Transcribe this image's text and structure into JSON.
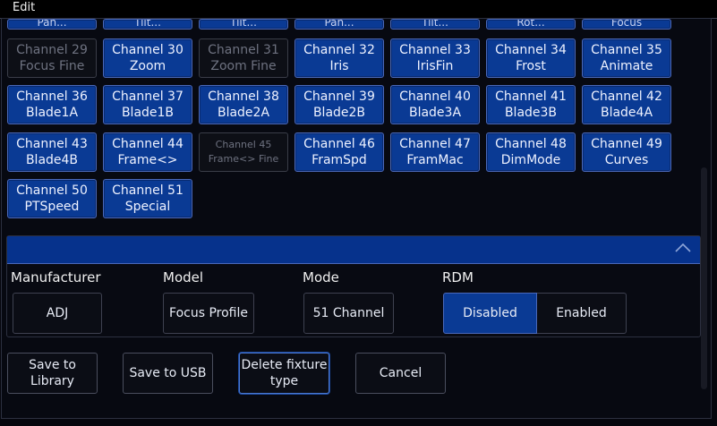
{
  "window": {
    "title": "Edit"
  },
  "channels": [
    {
      "num": "Channel 29",
      "name": "Focus Fine",
      "enabled": false
    },
    {
      "num": "Channel 30",
      "name": "Zoom",
      "enabled": true
    },
    {
      "num": "Channel 31",
      "name": "Zoom Fine",
      "enabled": false
    },
    {
      "num": "Channel 32",
      "name": "Iris",
      "enabled": true
    },
    {
      "num": "Channel 33",
      "name": "IrisFin",
      "enabled": true
    },
    {
      "num": "Channel 34",
      "name": "Frost",
      "enabled": true
    },
    {
      "num": "Channel 35",
      "name": "Animate",
      "enabled": true
    },
    {
      "num": "Channel 36",
      "name": "Blade1A",
      "enabled": true
    },
    {
      "num": "Channel 37",
      "name": "Blade1B",
      "enabled": true
    },
    {
      "num": "Channel 38",
      "name": "Blade2A",
      "enabled": true
    },
    {
      "num": "Channel 39",
      "name": "Blade2B",
      "enabled": true
    },
    {
      "num": "Channel 40",
      "name": "Blade3A",
      "enabled": true
    },
    {
      "num": "Channel 41",
      "name": "Blade3B",
      "enabled": true
    },
    {
      "num": "Channel 42",
      "name": "Blade4A",
      "enabled": true
    },
    {
      "num": "Channel 43",
      "name": "Blade4B",
      "enabled": true
    },
    {
      "num": "Channel 44",
      "name": "Frame<>",
      "enabled": true
    },
    {
      "num": "Channel 45",
      "name": "Frame<> Fine",
      "enabled": false,
      "small": true
    },
    {
      "num": "Channel 46",
      "name": "FramSpd",
      "enabled": true
    },
    {
      "num": "Channel 47",
      "name": "FramMac",
      "enabled": true
    },
    {
      "num": "Channel 48",
      "name": "DimMode",
      "enabled": true
    },
    {
      "num": "Channel 49",
      "name": "Curves",
      "enabled": true
    },
    {
      "num": "Channel 50",
      "name": "PTSpeed",
      "enabled": true
    },
    {
      "num": "Channel 51",
      "name": "Special",
      "enabled": true
    }
  ],
  "partial_row": [
    "Pan...",
    "Tilt...",
    "Tilt...",
    "Pan...",
    "Tilt...",
    "Rot...",
    "Focus"
  ],
  "properties": {
    "manufacturer": {
      "label": "Manufacturer",
      "value": "ADJ"
    },
    "model": {
      "label": "Model",
      "value": "Focus Profile"
    },
    "mode": {
      "label": "Mode",
      "value": "51 Channel"
    },
    "rdm": {
      "label": "RDM",
      "disabled": "Disabled",
      "enabled": "Enabled",
      "selected": "Disabled"
    }
  },
  "actions": {
    "save_library": "Save to Library",
    "save_usb": "Save to USB",
    "delete_type": "Delete fixture type",
    "cancel": "Cancel"
  },
  "icons": {
    "collapse": "chevron-up-icon"
  },
  "colors": {
    "accent": "#0a3a94",
    "background": "#05060d"
  }
}
